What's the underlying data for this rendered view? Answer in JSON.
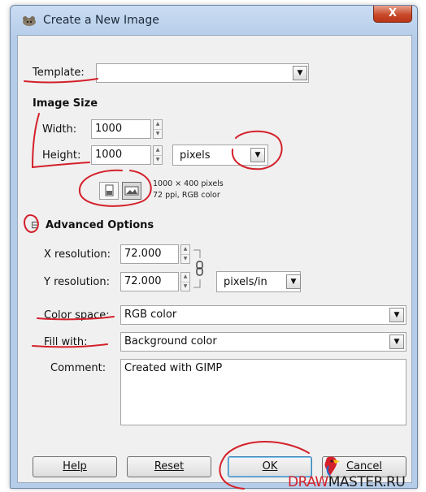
{
  "window": {
    "title": "Create a New Image",
    "close_label": "X"
  },
  "template": {
    "label": "Template:",
    "value": ""
  },
  "image_size": {
    "heading": "Image Size",
    "width_label": "Width:",
    "width_value": "1000",
    "height_label": "Height:",
    "height_value": "1000",
    "unit": "pixels",
    "info_line1": "1000 × 400 pixels",
    "info_line2": "72 ppi, RGB color"
  },
  "advanced": {
    "expander": "⊟",
    "heading": "Advanced Options",
    "x_res_label": "X resolution:",
    "x_res_value": "72.000",
    "y_res_label": "Y resolution:",
    "y_res_value": "72.000",
    "res_unit": "pixels/in",
    "color_space_label": "Color space:",
    "color_space_value": "RGB color",
    "fill_label": "Fill with:",
    "fill_value": "Background color",
    "comment_label": "Comment:",
    "comment_value": "Created with GIMP"
  },
  "buttons": {
    "help": "Help",
    "reset": "Reset",
    "ok": "OK",
    "cancel": "Cancel"
  },
  "watermark": {
    "part1": "DRAW",
    "part2": "MASTER.RU"
  },
  "colors": {
    "annotation": "#d4202a",
    "title_bar": "#b6cde9",
    "client": "#f0f0f0"
  }
}
